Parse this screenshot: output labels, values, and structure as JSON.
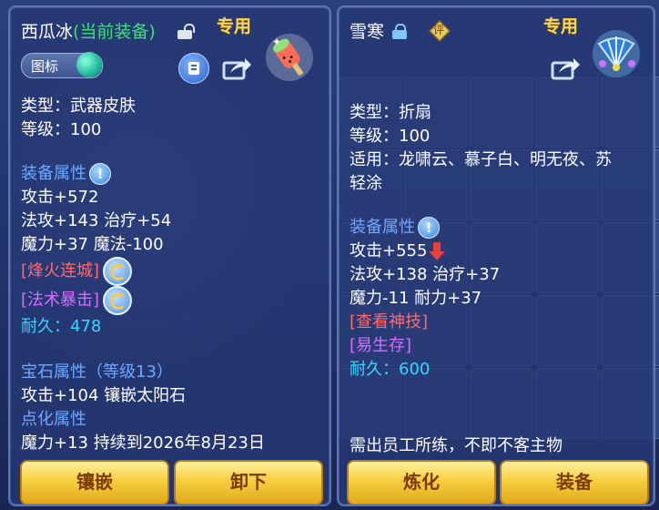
{
  "left": {
    "name": "西瓜冰",
    "equipped_tag": "(当前装备)",
    "special": "专用",
    "icon_toggle_label": "图标",
    "lines": {
      "type": "类型：武器皮肤",
      "level": "等级：100",
      "attr_header": "装备属性",
      "attack": "攻击+572",
      "magic_attack": "法攻+143 治疗+54",
      "mana": "魔力+37 魔法-100",
      "skill1": "[烽火连城]",
      "skill2": "[法术暴击]",
      "durability": "耐久：478",
      "gem_header": "宝石属性（等级13）",
      "gem_line": "攻击+104 镶嵌太阳石",
      "dot_header": "点化属性",
      "cut_line": "魔力+13 持续到2026年8月23日"
    },
    "buttons": {
      "inlay": "镶嵌",
      "unequip": "卸下"
    }
  },
  "right": {
    "name": "雪寒",
    "rate_badge": "评",
    "special": "专用",
    "lines": {
      "type": "类型：折扇",
      "level": "等级：100",
      "usable1": "适用：龙啸云、慕子白、明无夜、苏",
      "usable2": "轻涂",
      "attr_header": "装备属性",
      "attack": "攻击+555",
      "magic_attack": "法攻+138 治疗+37",
      "mana": "魔力-11 耐力+37",
      "skill1": "[查看神技]",
      "skill2": "[易生存]",
      "durability": "耐久：600",
      "cut_line": "需出员工所练，不即不客主物"
    },
    "buttons": {
      "refine": "炼化",
      "equip": "装备"
    }
  },
  "colors": {
    "equipped_green": "#3ce07a",
    "special_gold": "#ffd84a",
    "header_blue": "#6ea8ff",
    "skill_red": "#ff6a6a",
    "skill_purple": "#d96bff",
    "durability_cyan": "#35d6ff"
  },
  "icons": [
    "lock-open-icon",
    "lock-closed-icon",
    "toggle-knob-icon",
    "bag-icon",
    "share-icon",
    "popsicle-item-icon",
    "fan-item-icon",
    "info-icon",
    "refresh-icon",
    "down-arrow-icon"
  ]
}
